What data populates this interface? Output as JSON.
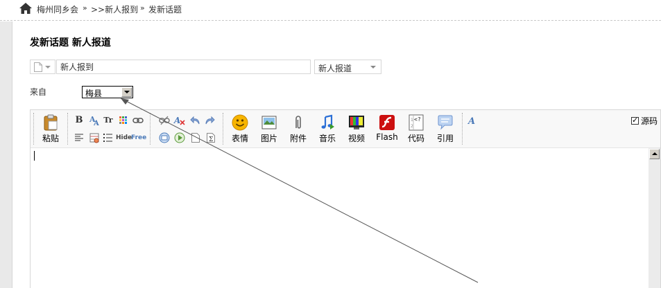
{
  "breadcrumb": {
    "site": "梅州同乡会",
    "sep1": "»",
    "item1": ">>新人报到",
    "sep2": "»",
    "item2": "发新话题"
  },
  "page_title": "发新话题 新人报道",
  "subject": {
    "value": "新人报到"
  },
  "category": {
    "selected": "新人报道"
  },
  "from": {
    "label": "来自",
    "selected": "梅县"
  },
  "toolbar": {
    "paste": "粘贴",
    "emoticon": "表情",
    "image": "图片",
    "attachment": "附件",
    "music": "音乐",
    "video": "视频",
    "flash": "Flash",
    "code": "代码",
    "quote": "引用",
    "hide": "Hide",
    "free": "Free",
    "bold": "B",
    "font_size": "Tr",
    "source_label": "源码",
    "source_checked": true
  },
  "colors": {
    "border": "#d6d6d6",
    "toolbar_bg": "#f8f8f8",
    "strip": "#e9e9e9"
  }
}
